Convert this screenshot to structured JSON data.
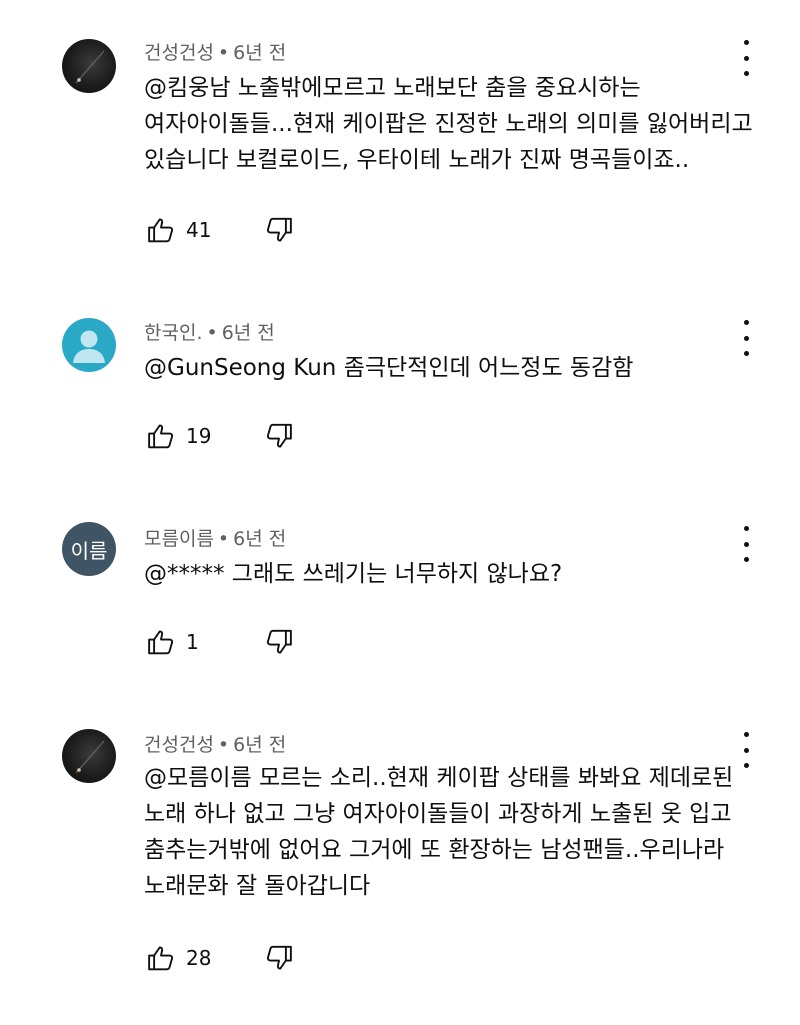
{
  "comments": [
    {
      "author": "건성건성",
      "time": "6년 전",
      "avatar": "photo",
      "text": "@킴웅남  노출밖에모르고 노래보단 춤을 중요시하는\n여자아이돌들...현재 케이팝은 진정한 노래의 의미를 잃어버리고\n있습니다 보컬로이드, 우타이테 노래가 진짜 명곡들이죠..",
      "likes": "41"
    },
    {
      "author": "한국인.",
      "time": "6년 전",
      "avatar": "default",
      "text": "@GunSeong Kun  좀극단적인데 어느정도 동감함",
      "likes": "19"
    },
    {
      "author": "모름이름",
      "time": "6년 전",
      "avatar": "text",
      "avatar_text": "이름",
      "text": "@*****  그래도 쓰레기는 너무하지 않나요?",
      "likes": "1"
    },
    {
      "author": "건성건성",
      "time": "6년 전",
      "avatar": "photo",
      "text": "@모름이름  모르는 소리..현재 케이팝 상태를 봐봐요 제데로된\n노래 하나 없고 그냥 여자아이돌들이 과장하게 노출된 옷 입고\n춤추는거밖에 없어요 그거에 또 환장하는 남성팬들..우리나라\n노래문화 잘 돌아갑니다",
      "likes": "28"
    }
  ],
  "separator": "•",
  "icons": {
    "like": "thumb-up-icon",
    "dislike": "thumb-down-icon",
    "menu": "more-vert-icon"
  }
}
